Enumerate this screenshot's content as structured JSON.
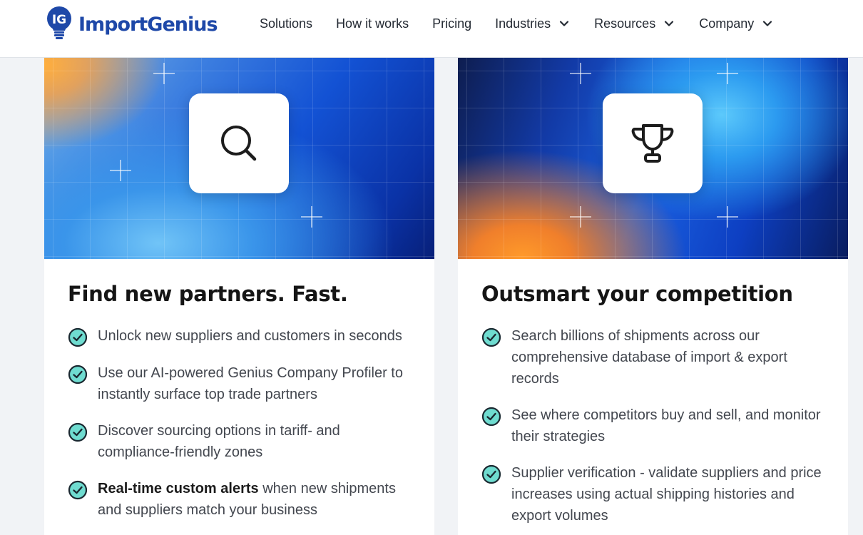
{
  "brand": {
    "logo_text": "ImportGenius",
    "logo_mark": "IG",
    "color": "#1e48a8"
  },
  "nav": {
    "items": [
      {
        "label": "Solutions",
        "dropdown": false
      },
      {
        "label": "How it works",
        "dropdown": false
      },
      {
        "label": "Pricing",
        "dropdown": false
      },
      {
        "label": "Industries",
        "dropdown": true
      },
      {
        "label": "Resources",
        "dropdown": true
      },
      {
        "label": "Company",
        "dropdown": true
      }
    ]
  },
  "cards": [
    {
      "icon": "search-icon",
      "title": "Find new partners. Fast.",
      "features": [
        {
          "bold": "",
          "text": "Unlock new suppliers and customers in seconds"
        },
        {
          "bold": "",
          "text": "Use our AI-powered Genius Company Profiler to instantly surface top trade partners"
        },
        {
          "bold": "",
          "text": "Discover sourcing options in tariff- and compliance-friendly zones"
        },
        {
          "bold": "Real-time custom alerts",
          "text": " when new shipments and suppliers match your business"
        }
      ]
    },
    {
      "icon": "trophy-icon",
      "title": "Outsmart your competition",
      "features": [
        {
          "bold": "",
          "text": "Search billions of shipments across our comprehensive database of import & export records"
        },
        {
          "bold": "",
          "text": "See where competitors buy and sell, and monitor their strategies"
        },
        {
          "bold": "",
          "text": "Supplier verification - validate suppliers and price increases using actual shipping histories and export volumes"
        }
      ]
    }
  ],
  "colors": {
    "check_fill": "#6fdcd0",
    "check_stroke": "#1a2830",
    "title": "#151515",
    "body_text": "#43474f"
  }
}
